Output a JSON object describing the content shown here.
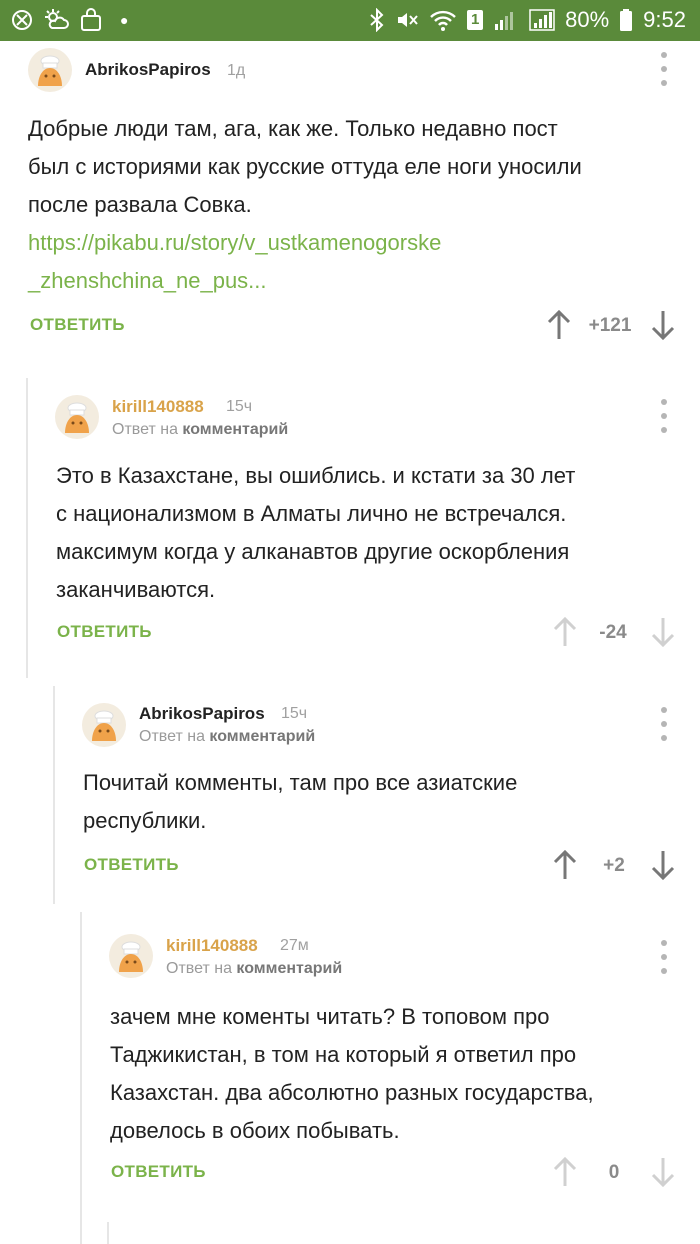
{
  "status": {
    "battery": "80%",
    "time": "9:52",
    "sim": "1"
  },
  "reply_to_prefix": "Ответ на",
  "reply_to_word": "комментарий",
  "reply_label": "ОТВЕТИТЬ",
  "comments": [
    {
      "author": "AbrikosPapiros",
      "time": "1д",
      "lines": [
        "Добрые люди там, ага, как же. Только недавно пост",
        "был с историями как русские оттуда еле ноги уносили",
        "после развала Совка."
      ],
      "link_lines": [
        "https://pikabu.ru/story/v_ustkamenogorske",
        "_zhenshchina_ne_pus..."
      ],
      "rating": "+121"
    },
    {
      "author": "kirill140888",
      "time": "15ч",
      "lines": [
        "Это в Казахстане, вы ошиблись. и кстати за 30 лет",
        "с национализмом в Алматы лично не встречался.",
        "максимум когда у алканавтов другие оскорбления",
        "заканчиваются."
      ],
      "rating": "-24"
    },
    {
      "author": "AbrikosPapiros",
      "time": "15ч",
      "lines": [
        "Почитай комменты, там про все азиатские",
        "республики."
      ],
      "rating": "+2"
    },
    {
      "author": "kirill140888",
      "time": "27м",
      "lines": [
        "зачем мне коменты читать? В топовом про",
        "Таджикистан, в том на который я ответил про",
        "Казахстан. два абсолютно разных государства,",
        "довелось в обоих побывать."
      ],
      "rating": "0"
    }
  ]
}
